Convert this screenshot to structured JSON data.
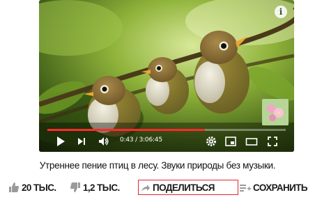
{
  "player": {
    "time_display": "0:43 / 3:06:45",
    "progress_fraction": 0.66,
    "progress_color": "#ff2a2a",
    "icons": [
      "play-icon",
      "next-icon",
      "volume-icon",
      "settings-icon",
      "miniplayer-icon",
      "theater-icon",
      "fullscreen-icon",
      "info-icon"
    ]
  },
  "video": {
    "title": "Утреннее пение птиц в лесу. Звуки природы без музыки."
  },
  "actions": {
    "like_count": "20 ТЫС.",
    "dislike_count": "1,2 ТЫС.",
    "share_label": "ПОДЕЛИТЬСЯ",
    "save_label": "СОХРАНИТЬ",
    "highlight_color": "#e2272e"
  }
}
